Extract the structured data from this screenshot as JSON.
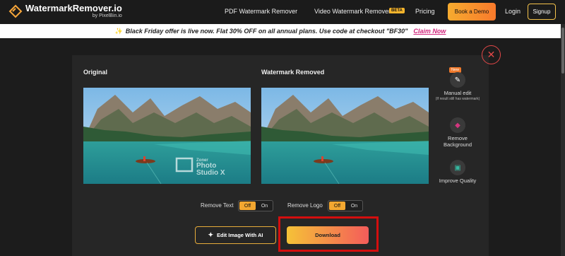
{
  "nav": {
    "brand_title": "WatermarkRemover.io",
    "brand_sub": "by PixelBin.io",
    "links": [
      {
        "label": "PDF Watermark Remover"
      },
      {
        "label": "Video Watermark Remover"
      },
      {
        "label": "Pricing"
      },
      {
        "label": "Login"
      }
    ],
    "beta_label": "BETA",
    "book_demo_label": "Book a Demo",
    "signup_label": "Signup"
  },
  "promo": {
    "message": "Black Friday offer is live now. Flat 30% OFF on all annual plans. Use code at checkout \"BF30\"",
    "claim_label": "Claim Now"
  },
  "editor": {
    "original_label": "Original",
    "removed_label": "Watermark Removed",
    "close_icon": "close-icon",
    "tools": [
      {
        "label": "Manual edit",
        "note": "(If result still has watermark)",
        "badge": "New",
        "icon": "pencil-icon"
      },
      {
        "label": "Remove Background",
        "icon": "remove-background-icon"
      },
      {
        "label": "Improve Quality",
        "icon": "improve-quality-icon"
      }
    ],
    "toggles": {
      "remove_text_label": "Remove Text",
      "remove_logo_label": "Remove Logo",
      "off_label": "Off",
      "on_label": "On"
    },
    "edit_ai_label": "Edit Image With AI",
    "download_label": "Download",
    "watermark_text": {
      "line1": "Zoner",
      "line2": "Photo",
      "line3": "Studio X"
    }
  },
  "colors": {
    "accent": "#f3a730",
    "claim": "#d1247b",
    "highlight": "#d40e0e"
  }
}
